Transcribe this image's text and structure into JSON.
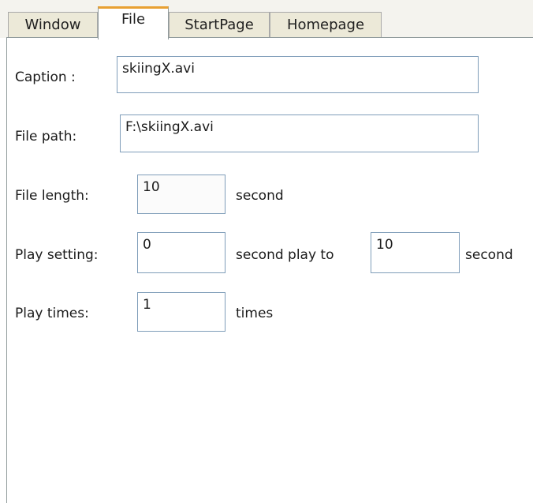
{
  "tabs": [
    {
      "label": "Window"
    },
    {
      "label": "File"
    },
    {
      "label": "StartPage"
    },
    {
      "label": "Homepage"
    }
  ],
  "active_tab": "File",
  "accent_color": "#e8a032",
  "form": {
    "caption_label": "Caption :",
    "caption_value": "skiingX.avi",
    "file_path_label": "File path:",
    "file_path_value": "F:\\skiingX.avi",
    "file_length_label": "File length:",
    "file_length_value": "10",
    "file_length_unit": "second",
    "play_setting_label": "Play setting:",
    "play_from_value": "0",
    "play_to_label": "second play to",
    "play_to_value": "10",
    "play_to_unit": "second",
    "play_times_label": "Play times:",
    "play_times_value": "1",
    "play_times_unit": "times"
  }
}
